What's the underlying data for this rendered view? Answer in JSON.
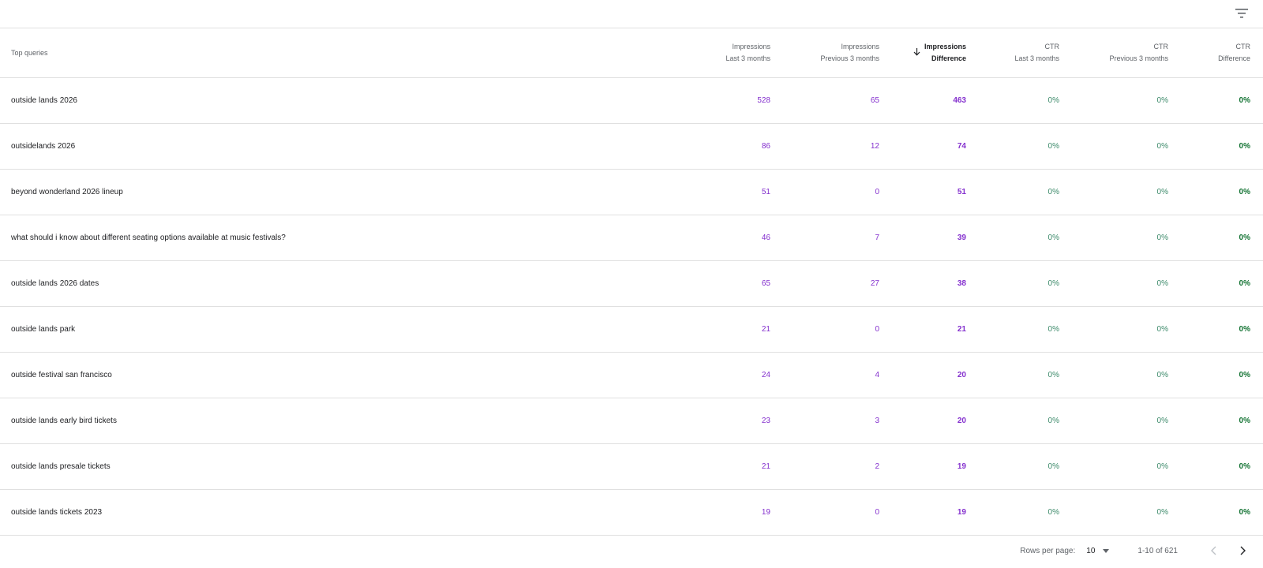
{
  "toolbar": {
    "filter_icon": "filter-icon"
  },
  "table": {
    "headers": {
      "query": "Top queries",
      "imp_last": [
        "Impressions",
        "Last 3 months"
      ],
      "imp_prev": [
        "Impressions",
        "Previous 3 months"
      ],
      "imp_diff": [
        "Impressions",
        "Difference"
      ],
      "ctr_last": [
        "CTR",
        "Last 3 months"
      ],
      "ctr_prev": [
        "CTR",
        "Previous 3 months"
      ],
      "ctr_diff": [
        "CTR",
        "Difference"
      ]
    },
    "sort_icon": "arrow-down-icon",
    "rows": [
      {
        "query": "outside lands 2026",
        "imp_last": "528",
        "imp_prev": "65",
        "imp_diff": "463",
        "ctr_last": "0%",
        "ctr_prev": "0%",
        "ctr_diff": "0%"
      },
      {
        "query": "outsidelands 2026",
        "imp_last": "86",
        "imp_prev": "12",
        "imp_diff": "74",
        "ctr_last": "0%",
        "ctr_prev": "0%",
        "ctr_diff": "0%"
      },
      {
        "query": "beyond wonderland 2026 lineup",
        "imp_last": "51",
        "imp_prev": "0",
        "imp_diff": "51",
        "ctr_last": "0%",
        "ctr_prev": "0%",
        "ctr_diff": "0%"
      },
      {
        "query": "what should i know about different seating options available at music festivals?",
        "imp_last": "46",
        "imp_prev": "7",
        "imp_diff": "39",
        "ctr_last": "0%",
        "ctr_prev": "0%",
        "ctr_diff": "0%"
      },
      {
        "query": "outside lands 2026 dates",
        "imp_last": "65",
        "imp_prev": "27",
        "imp_diff": "38",
        "ctr_last": "0%",
        "ctr_prev": "0%",
        "ctr_diff": "0%"
      },
      {
        "query": "outside lands park",
        "imp_last": "21",
        "imp_prev": "0",
        "imp_diff": "21",
        "ctr_last": "0%",
        "ctr_prev": "0%",
        "ctr_diff": "0%"
      },
      {
        "query": "outside festival san francisco",
        "imp_last": "24",
        "imp_prev": "4",
        "imp_diff": "20",
        "ctr_last": "0%",
        "ctr_prev": "0%",
        "ctr_diff": "0%"
      },
      {
        "query": "outside lands early bird tickets",
        "imp_last": "23",
        "imp_prev": "3",
        "imp_diff": "20",
        "ctr_last": "0%",
        "ctr_prev": "0%",
        "ctr_diff": "0%"
      },
      {
        "query": "outside lands presale tickets",
        "imp_last": "21",
        "imp_prev": "2",
        "imp_diff": "19",
        "ctr_last": "0%",
        "ctr_prev": "0%",
        "ctr_diff": "0%"
      },
      {
        "query": "outside lands tickets 2023",
        "imp_last": "19",
        "imp_prev": "0",
        "imp_diff": "19",
        "ctr_last": "0%",
        "ctr_prev": "0%",
        "ctr_diff": "0%"
      }
    ]
  },
  "pagination": {
    "rows_per_page_label": "Rows per page:",
    "rows_per_page_value": "10",
    "range": "1-10 of 621",
    "prev_icon": "chevron-left-icon",
    "next_icon": "chevron-right-icon"
  },
  "colors": {
    "impressions": "#8430ce",
    "ctr": "#188038",
    "border": "#e0e0e0"
  }
}
